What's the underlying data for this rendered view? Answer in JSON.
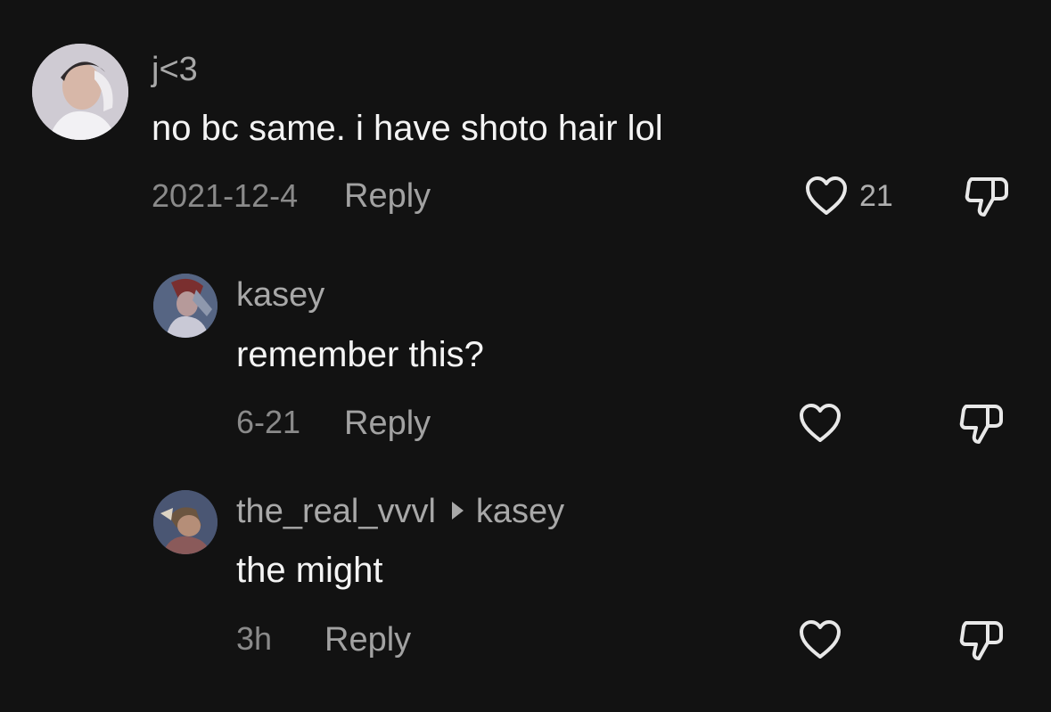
{
  "comments": [
    {
      "username": "j<3",
      "text": "no bc same. i have shoto hair lol",
      "date": "2021-12-4",
      "reply_label": "Reply",
      "like_count": "21"
    },
    {
      "username": "kasey",
      "text": "remember this?",
      "date": "6-21",
      "reply_label": "Reply"
    },
    {
      "username": "the_real_vvvl",
      "reply_to": "kasey",
      "text": "the might",
      "date": "3h",
      "reply_label": "Reply"
    }
  ],
  "colors": {
    "background": "#121212",
    "username": "#a8a8a8",
    "text": "#f4f4f4",
    "meta": "#8a8a8a",
    "icon": "#e8e8e8"
  },
  "icons": {
    "like": "heart-outline-icon",
    "dislike": "thumbs-down-outline-icon",
    "reply_arrow": "triangle-right-icon"
  }
}
